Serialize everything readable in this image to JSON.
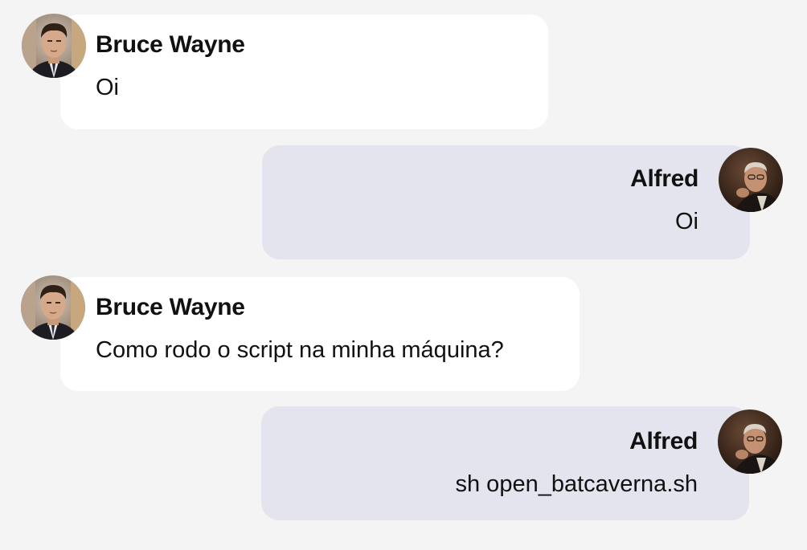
{
  "messages": [
    {
      "sender": "Bruce Wayne",
      "text": "Oi",
      "direction": "incoming",
      "avatar_icon": "bruce-wayne-avatar"
    },
    {
      "sender": "Alfred",
      "text": "Oi",
      "direction": "outgoing",
      "avatar_icon": "alfred-avatar"
    },
    {
      "sender": "Bruce Wayne",
      "text": "Como rodo o script na minha máquina?",
      "direction": "incoming",
      "avatar_icon": "bruce-wayne-avatar"
    },
    {
      "sender": "Alfred",
      "text": "sh open_batcaverna.sh",
      "direction": "outgoing",
      "avatar_icon": "alfred-avatar"
    }
  ],
  "colors": {
    "page_background": "#f4f4f4",
    "incoming_bubble": "#ffffff",
    "outgoing_bubble": "#e4e4ef",
    "text": "#111111"
  }
}
